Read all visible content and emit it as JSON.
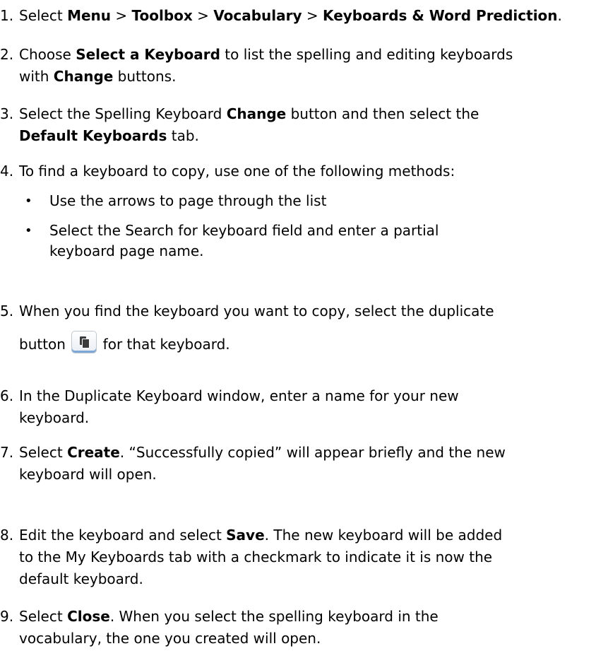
{
  "steps": [
    {
      "number": "1.",
      "lines": [
        {
          "parts": [
            {
              "text": "Select ",
              "bold": false
            },
            {
              "text": "Menu",
              "bold": true
            },
            {
              "text": " > ",
              "bold": false
            },
            {
              "text": "Toolbox",
              "bold": true
            },
            {
              "text": " > ",
              "bold": false
            },
            {
              "text": "Vocabulary",
              "bold": true
            },
            {
              "text": " > ",
              "bold": false
            },
            {
              "text": "Keyboards & Word Prediction",
              "bold": true
            },
            {
              "text": ".",
              "bold": false
            }
          ]
        }
      ]
    },
    {
      "number": "2.",
      "lines": [
        {
          "parts": [
            {
              "text": "Choose ",
              "bold": false
            },
            {
              "text": "Select a Keyboard",
              "bold": true
            },
            {
              "text": " to list the spelling and editing keyboards",
              "bold": false
            }
          ]
        },
        {
          "parts": [
            {
              "text": "with ",
              "bold": false
            },
            {
              "text": "Change",
              "bold": true
            },
            {
              "text": " buttons.",
              "bold": false
            }
          ]
        }
      ]
    },
    {
      "number": "3.",
      "lines": [
        {
          "parts": [
            {
              "text": "Select the Spelling Keyboard ",
              "bold": false
            },
            {
              "text": "Change",
              "bold": true
            },
            {
              "text": " button and then select the",
              "bold": false
            }
          ]
        },
        {
          "parts": [
            {
              "text": "Default Keyboards",
              "bold": true
            },
            {
              "text": " tab.",
              "bold": false
            }
          ]
        }
      ]
    },
    {
      "number": "4.",
      "lines": [
        {
          "parts": [
            {
              "text": "To find a keyboard to copy, use one of the following methods:",
              "bold": false
            }
          ]
        }
      ],
      "bullets": [
        {
          "lines": [
            "Use the arrows to page through the list"
          ]
        },
        {
          "lines": [
            "Select the Search for keyboard field and enter a partial",
            "keyboard page name."
          ]
        }
      ]
    },
    {
      "number": "5.",
      "lines": [
        {
          "parts": [
            {
              "text": "When you find the keyboard you want to copy, select the duplicate",
              "bold": false
            }
          ]
        },
        {
          "parts": [
            {
              "text": "button ",
              "bold": false
            },
            {
              "icon": "duplicate-icon"
            },
            {
              "text": " for that keyboard.",
              "bold": false
            }
          ]
        }
      ]
    },
    {
      "number": "6.",
      "lines": [
        {
          "parts": [
            {
              "text": "In the Duplicate Keyboard window, enter a name for your new",
              "bold": false
            }
          ]
        },
        {
          "parts": [
            {
              "text": "keyboard.",
              "bold": false
            }
          ]
        }
      ]
    },
    {
      "number": "7.",
      "lines": [
        {
          "parts": [
            {
              "text": "Select ",
              "bold": false
            },
            {
              "text": "Create",
              "bold": true
            },
            {
              "text": ". “Successfully copied” will appear briefly and the new",
              "bold": false
            }
          ]
        },
        {
          "parts": [
            {
              "text": "keyboard will open.",
              "bold": false
            }
          ]
        }
      ]
    },
    {
      "number": "8.",
      "lines": [
        {
          "parts": [
            {
              "text": "Edit the keyboard and select ",
              "bold": false
            },
            {
              "text": "Save",
              "bold": true
            },
            {
              "text": ". The new keyboard will be added",
              "bold": false
            }
          ]
        },
        {
          "parts": [
            {
              "text": "to the My Keyboards tab with a checkmark to indicate it is now the",
              "bold": false
            }
          ]
        },
        {
          "parts": [
            {
              "text": "default keyboard.",
              "bold": false
            }
          ]
        }
      ]
    },
    {
      "number": "9.",
      "lines": [
        {
          "parts": [
            {
              "text": "Select ",
              "bold": false
            },
            {
              "text": "Close",
              "bold": true
            },
            {
              "text": ". When you select the spelling keyboard in the",
              "bold": false
            }
          ]
        },
        {
          "parts": [
            {
              "text": "vocabulary, the one you created will open.",
              "bold": false
            }
          ]
        }
      ]
    }
  ]
}
